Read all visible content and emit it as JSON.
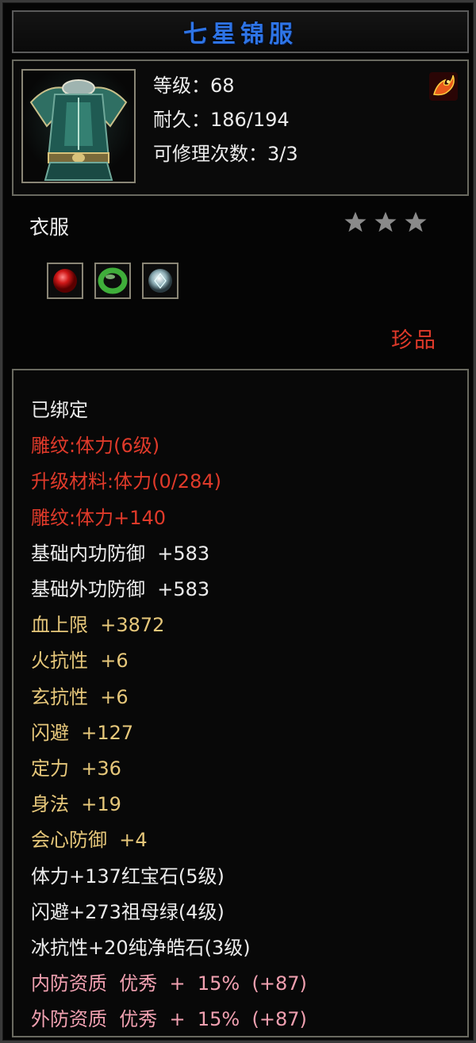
{
  "title": "七星锦服",
  "header": {
    "level": "等级：68",
    "durability": "耐久：186/194",
    "repair": "可修理次数：3/3",
    "type_badge_icon": "fire-dragon-icon",
    "item_icon": "armor-icon"
  },
  "category": "衣服",
  "stars": {
    "count": 3,
    "color": "#8a8a8a"
  },
  "gems": [
    "ruby-gem-icon",
    "emerald-gem-icon",
    "diamond-gem-icon"
  ],
  "rarity": "珍品",
  "colors": {
    "white": "#ececec",
    "red": "#e03a2a",
    "gold": "#e6c77a",
    "pink": "#f0a0b0",
    "title": "#2e74e6"
  },
  "attributes": [
    {
      "text": "已绑定",
      "color": "white"
    },
    {
      "text": "雕纹:体力(6级)",
      "color": "red"
    },
    {
      "text": "升级材料:体力(0/284)",
      "color": "red"
    },
    {
      "text": "雕纹:体力+140",
      "color": "red"
    },
    {
      "text": "基础内功防御  +583",
      "color": "white"
    },
    {
      "text": "基础外功防御  +583",
      "color": "white"
    },
    {
      "text": "血上限  +3872",
      "color": "gold"
    },
    {
      "text": "火抗性  +6",
      "color": "gold"
    },
    {
      "text": "玄抗性  +6",
      "color": "gold"
    },
    {
      "text": "闪避  +127",
      "color": "gold"
    },
    {
      "text": "定力  +36",
      "color": "gold"
    },
    {
      "text": "身法  +19",
      "color": "gold"
    },
    {
      "text": "会心防御  +4",
      "color": "gold"
    },
    {
      "text": "体力+137红宝石(5级)",
      "color": "white"
    },
    {
      "text": "闪避+273祖母绿(4级)",
      "color": "white"
    },
    {
      "text": "冰抗性+20纯净皓石(3级)",
      "color": "white"
    },
    {
      "text": "内防资质  优秀  +  15%  (+87)",
      "color": "pink"
    },
    {
      "text": "外防资质  优秀  +  15%  (+87)",
      "color": "pink"
    }
  ]
}
